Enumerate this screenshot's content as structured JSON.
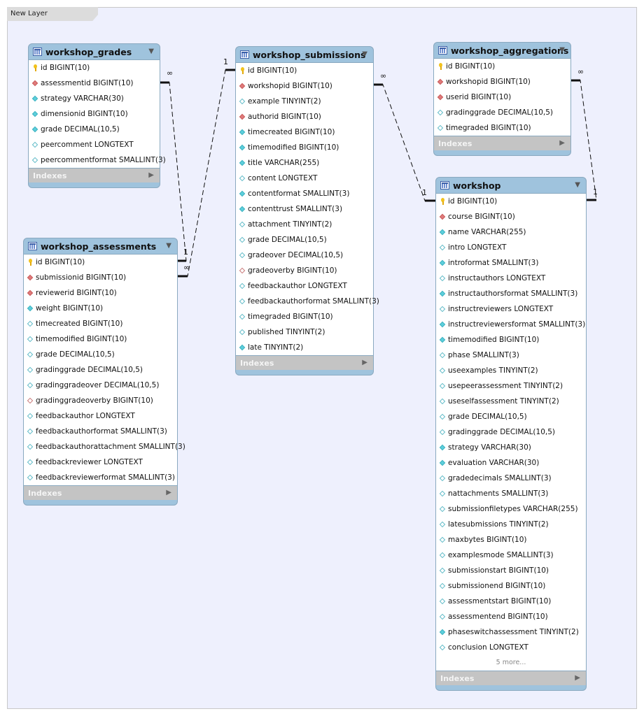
{
  "layer": {
    "name": "New Layer"
  },
  "tables": {
    "workshop_grades": {
      "name": "workshop_grades",
      "columns": [
        {
          "name": "id BIGINT(10)",
          "icon": "pk"
        },
        {
          "name": "assessmentid BIGINT(10)",
          "icon": "fk"
        },
        {
          "name": "strategy VARCHAR(30)",
          "icon": "nn"
        },
        {
          "name": "dimensionid BIGINT(10)",
          "icon": "nn"
        },
        {
          "name": "grade DECIMAL(10,5)",
          "icon": "nn"
        },
        {
          "name": "peercomment LONGTEXT",
          "icon": "nul"
        },
        {
          "name": "peercommentformat SMALLINT(3)",
          "icon": "nul"
        }
      ],
      "indexes_label": "Indexes"
    },
    "workshop_submissions": {
      "name": "workshop_submissions",
      "columns": [
        {
          "name": "id BIGINT(10)",
          "icon": "pk"
        },
        {
          "name": "workshopid BIGINT(10)",
          "icon": "fk"
        },
        {
          "name": "example TINYINT(2)",
          "icon": "nul"
        },
        {
          "name": "authorid BIGINT(10)",
          "icon": "fk"
        },
        {
          "name": "timecreated BIGINT(10)",
          "icon": "nn"
        },
        {
          "name": "timemodified BIGINT(10)",
          "icon": "nn"
        },
        {
          "name": "title VARCHAR(255)",
          "icon": "nn"
        },
        {
          "name": "content LONGTEXT",
          "icon": "nul"
        },
        {
          "name": "contentformat SMALLINT(3)",
          "icon": "nn"
        },
        {
          "name": "contenttrust SMALLINT(3)",
          "icon": "nn"
        },
        {
          "name": "attachment TINYINT(2)",
          "icon": "nul"
        },
        {
          "name": "grade DECIMAL(10,5)",
          "icon": "nul"
        },
        {
          "name": "gradeover DECIMAL(10,5)",
          "icon": "nul"
        },
        {
          "name": "gradeoverby BIGINT(10)",
          "icon": "fkn"
        },
        {
          "name": "feedbackauthor LONGTEXT",
          "icon": "nul"
        },
        {
          "name": "feedbackauthorformat SMALLINT(3)",
          "icon": "nul"
        },
        {
          "name": "timegraded BIGINT(10)",
          "icon": "nul"
        },
        {
          "name": "published TINYINT(2)",
          "icon": "nul"
        },
        {
          "name": "late TINYINT(2)",
          "icon": "nn"
        }
      ],
      "indexes_label": "Indexes"
    },
    "workshop_aggregations": {
      "name": "workshop_aggregations",
      "columns": [
        {
          "name": "id BIGINT(10)",
          "icon": "pk"
        },
        {
          "name": "workshopid BIGINT(10)",
          "icon": "fk"
        },
        {
          "name": "userid BIGINT(10)",
          "icon": "fk"
        },
        {
          "name": "gradinggrade DECIMAL(10,5)",
          "icon": "nul"
        },
        {
          "name": "timegraded BIGINT(10)",
          "icon": "nul"
        }
      ],
      "indexes_label": "Indexes"
    },
    "workshop_assessments": {
      "name": "workshop_assessments",
      "columns": [
        {
          "name": "id BIGINT(10)",
          "icon": "pk"
        },
        {
          "name": "submissionid BIGINT(10)",
          "icon": "fk"
        },
        {
          "name": "reviewerid BIGINT(10)",
          "icon": "fk"
        },
        {
          "name": "weight BIGINT(10)",
          "icon": "nn"
        },
        {
          "name": "timecreated BIGINT(10)",
          "icon": "nul"
        },
        {
          "name": "timemodified BIGINT(10)",
          "icon": "nul"
        },
        {
          "name": "grade DECIMAL(10,5)",
          "icon": "nul"
        },
        {
          "name": "gradinggrade DECIMAL(10,5)",
          "icon": "nul"
        },
        {
          "name": "gradinggradeover DECIMAL(10,5)",
          "icon": "nul"
        },
        {
          "name": "gradinggradeoverby BIGINT(10)",
          "icon": "fkn"
        },
        {
          "name": "feedbackauthor LONGTEXT",
          "icon": "nul"
        },
        {
          "name": "feedbackauthorformat SMALLINT(3)",
          "icon": "nul"
        },
        {
          "name": "feedbackauthorattachment SMALLINT(3)",
          "icon": "nul"
        },
        {
          "name": "feedbackreviewer LONGTEXT",
          "icon": "nul"
        },
        {
          "name": "feedbackreviewerformat SMALLINT(3)",
          "icon": "nul"
        }
      ],
      "indexes_label": "Indexes"
    },
    "workshop": {
      "name": "workshop",
      "columns": [
        {
          "name": "id BIGINT(10)",
          "icon": "pk"
        },
        {
          "name": "course BIGINT(10)",
          "icon": "fk"
        },
        {
          "name": "name VARCHAR(255)",
          "icon": "nn"
        },
        {
          "name": "intro LONGTEXT",
          "icon": "nul"
        },
        {
          "name": "introformat SMALLINT(3)",
          "icon": "nn"
        },
        {
          "name": "instructauthors LONGTEXT",
          "icon": "nul"
        },
        {
          "name": "instructauthorsformat SMALLINT(3)",
          "icon": "nn"
        },
        {
          "name": "instructreviewers LONGTEXT",
          "icon": "nul"
        },
        {
          "name": "instructreviewersformat SMALLINT(3)",
          "icon": "nn"
        },
        {
          "name": "timemodified BIGINT(10)",
          "icon": "nn"
        },
        {
          "name": "phase SMALLINT(3)",
          "icon": "nul"
        },
        {
          "name": "useexamples TINYINT(2)",
          "icon": "nul"
        },
        {
          "name": "usepeerassessment TINYINT(2)",
          "icon": "nul"
        },
        {
          "name": "useselfassessment TINYINT(2)",
          "icon": "nul"
        },
        {
          "name": "grade DECIMAL(10,5)",
          "icon": "nul"
        },
        {
          "name": "gradinggrade DECIMAL(10,5)",
          "icon": "nul"
        },
        {
          "name": "strategy VARCHAR(30)",
          "icon": "nn"
        },
        {
          "name": "evaluation VARCHAR(30)",
          "icon": "nn"
        },
        {
          "name": "gradedecimals SMALLINT(3)",
          "icon": "nul"
        },
        {
          "name": "nattachments SMALLINT(3)",
          "icon": "nul"
        },
        {
          "name": "submissionfiletypes VARCHAR(255)",
          "icon": "nul"
        },
        {
          "name": "latesubmissions TINYINT(2)",
          "icon": "nul"
        },
        {
          "name": "maxbytes BIGINT(10)",
          "icon": "nul"
        },
        {
          "name": "examplesmode SMALLINT(3)",
          "icon": "nul"
        },
        {
          "name": "submissionstart BIGINT(10)",
          "icon": "nul"
        },
        {
          "name": "submissionend BIGINT(10)",
          "icon": "nul"
        },
        {
          "name": "assessmentstart BIGINT(10)",
          "icon": "nul"
        },
        {
          "name": "assessmentend BIGINT(10)",
          "icon": "nul"
        },
        {
          "name": "phaseswitchassessment TINYINT(2)",
          "icon": "nn"
        },
        {
          "name": "conclusion LONGTEXT",
          "icon": "nul"
        }
      ],
      "more_label": "5 more...",
      "indexes_label": "Indexes"
    }
  },
  "icon_legend": {
    "pk": "primary-key-icon",
    "fk": "foreign-key-icon",
    "fkn": "nullable-foreign-key-icon",
    "nn": "not-null-column-icon",
    "nul": "nullable-column-icon"
  },
  "relationships": [
    {
      "from": "workshop_grades",
      "to": "workshop_assessments",
      "from_card": "∞",
      "to_card": "1"
    },
    {
      "from": "workshop_assessments",
      "to": "workshop_submissions",
      "from_card": "∞",
      "to_card": "1"
    },
    {
      "from": "workshop_submissions",
      "to": "workshop",
      "from_card": "∞",
      "to_card": "1"
    },
    {
      "from": "workshop_aggregations",
      "to": "workshop",
      "from_card": "∞",
      "to_card": "1"
    }
  ]
}
